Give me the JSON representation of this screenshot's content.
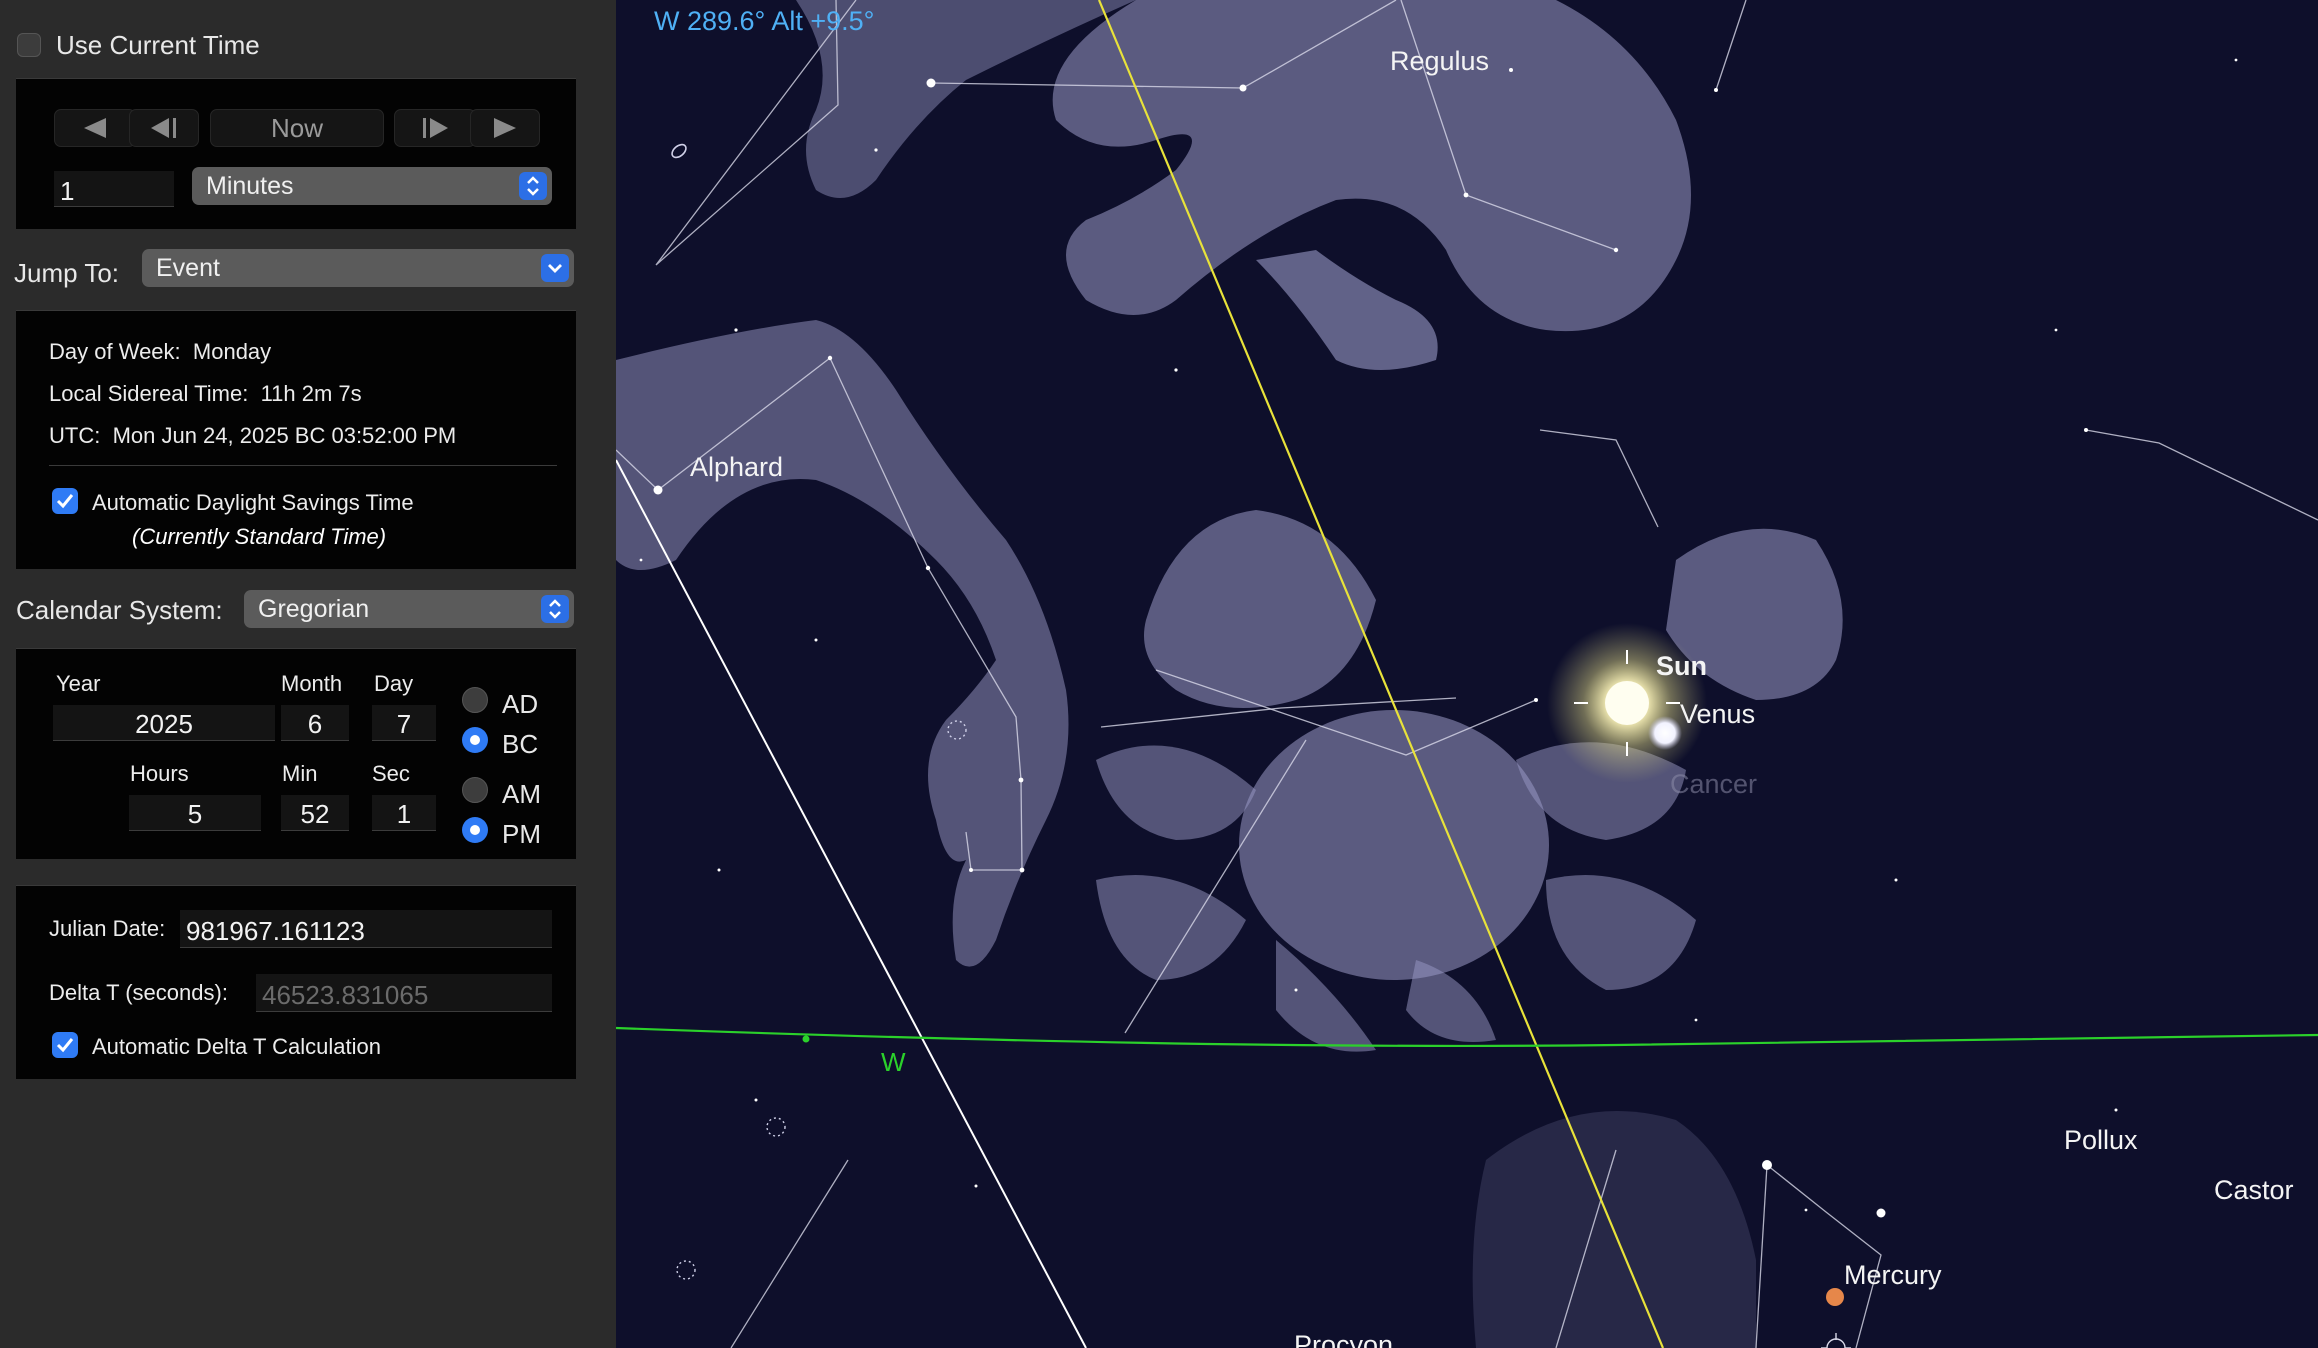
{
  "sidebar": {
    "use_current_time": {
      "label": "Use Current Time",
      "checked": false
    },
    "step_controls": {
      "now_label": "Now",
      "step_value": "1",
      "step_unit": "Minutes"
    },
    "jump_to": {
      "label": "Jump To:",
      "value": "Event"
    },
    "info": {
      "day_of_week_label": "Day of Week:",
      "day_of_week": "Monday",
      "sidereal_label": "Local Sidereal Time:",
      "sidereal": "11h 2m 7s",
      "utc_label": "UTC:",
      "utc": "Mon Jun 24, 2025 BC 03:52:00 PM",
      "dst_label": "Automatic Daylight Savings Time",
      "dst_checked": true,
      "dst_note": "(Currently Standard Time)"
    },
    "calendar": {
      "label": "Calendar System:",
      "value": "Gregorian"
    },
    "date": {
      "year_label": "Year",
      "year": "2025",
      "month_label": "Month",
      "month": "6",
      "day_label": "Day",
      "day": "7",
      "hours_label": "Hours",
      "hours": "5",
      "min_label": "Min",
      "min": "52",
      "sec_label": "Sec",
      "sec": "1",
      "ad_label": "AD",
      "bc_label": "BC",
      "era": "BC",
      "am_label": "AM",
      "pm_label": "PM",
      "meridiem": "PM"
    },
    "julian": {
      "julian_label": "Julian Date:",
      "julian_value": "981967.161123",
      "delta_label": "Delta T (seconds):",
      "delta_value": "46523.831065",
      "auto_delta_label": "Automatic Delta T Calculation",
      "auto_delta_checked": true
    }
  },
  "sky": {
    "readout": "W 289.6° Alt +9.5°",
    "labels": {
      "regulus": "Regulus",
      "alphard": "Alphard",
      "sun": "Sun",
      "venus": "Venus",
      "cancer": "Cancer",
      "west": "W",
      "pollux": "Pollux",
      "castor": "Castor",
      "mercury": "Mercury",
      "procyon": "Procyon"
    },
    "colors": {
      "background": "#0e0f2b",
      "ecliptic": "#e8e23a",
      "horizon": "#2bd12b",
      "readout": "#4fb0f5",
      "sun": "#fff7c0",
      "mercury": "#e6874a"
    }
  }
}
